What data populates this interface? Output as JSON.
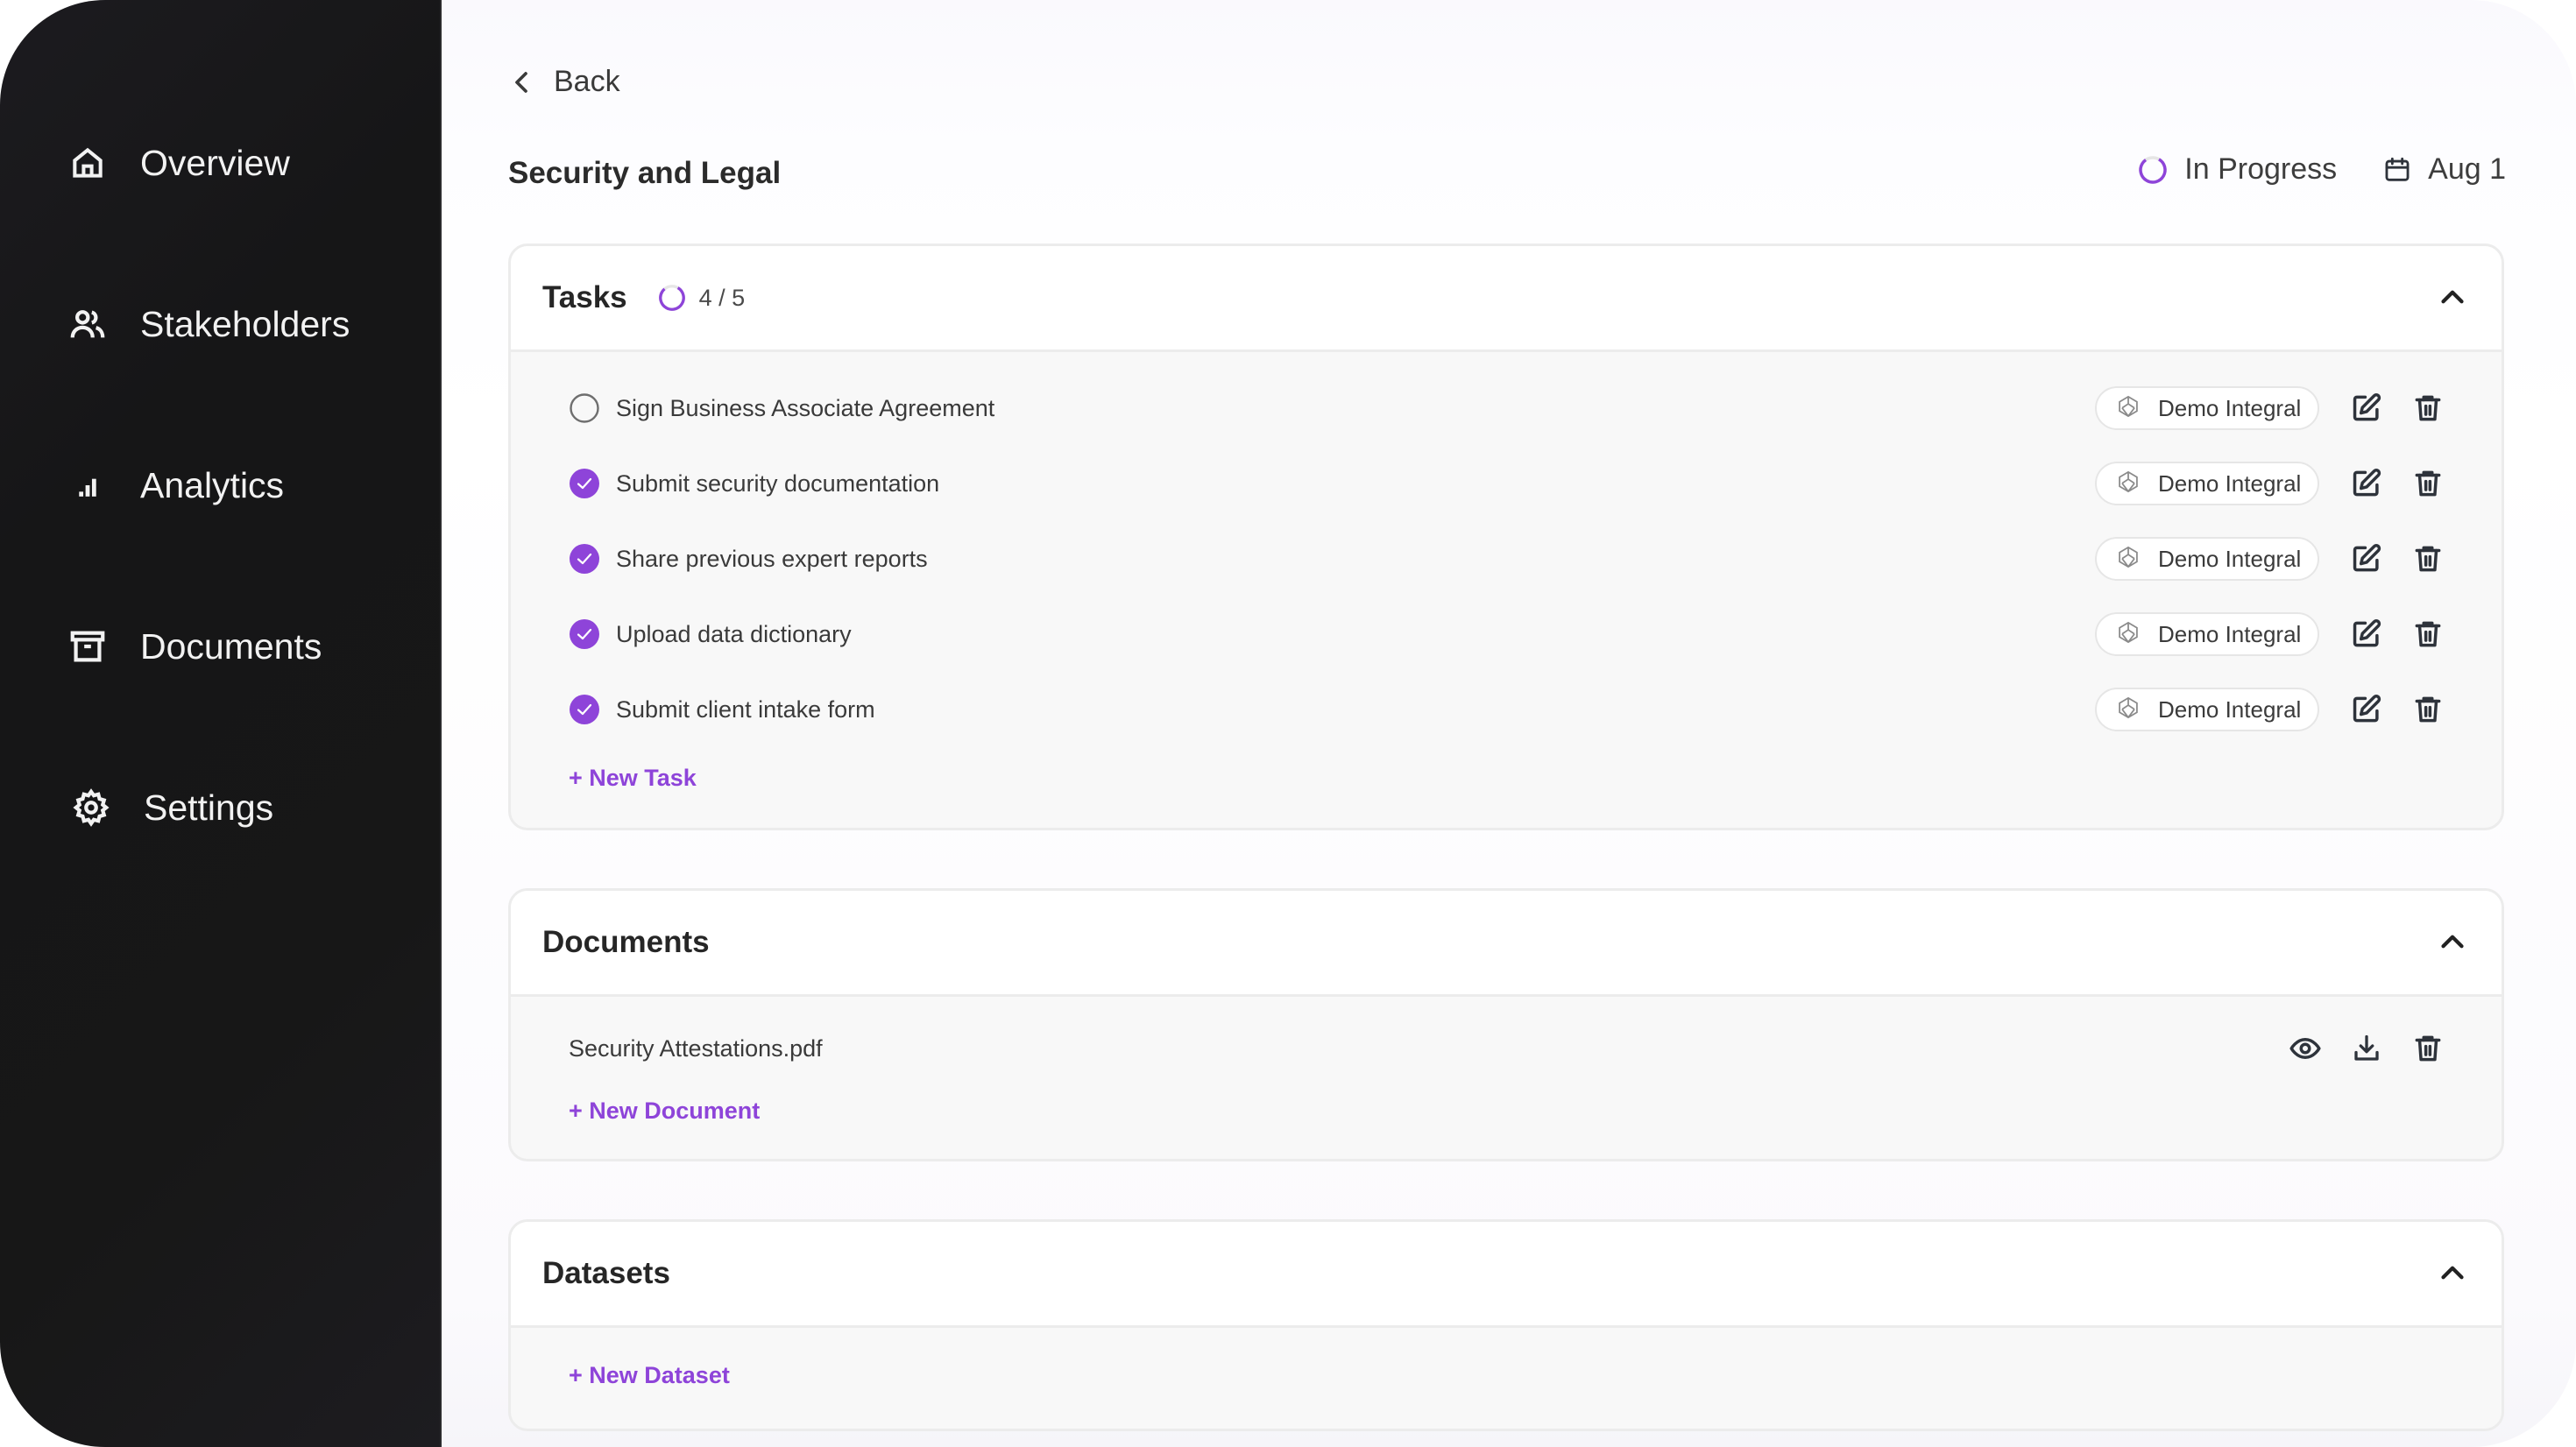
{
  "colors": {
    "accent": "#8e44d9",
    "sidebar_bg": "#171717",
    "sidebar_text": "#f2f2f2",
    "text_primary": "#2b2b2b",
    "icon_dark": "#2e333b"
  },
  "sidebar": {
    "items": [
      {
        "label": "Overview",
        "icon": "home-icon"
      },
      {
        "label": "Stakeholders",
        "icon": "users-icon"
      },
      {
        "label": "Analytics",
        "icon": "bar-chart-icon"
      },
      {
        "label": "Documents",
        "icon": "archive-box-icon"
      },
      {
        "label": "Settings",
        "icon": "gear-icon"
      }
    ]
  },
  "header": {
    "back_label": "Back",
    "title": "Security and Legal",
    "status": {
      "label": "In Progress",
      "icon": "progress-ring-icon"
    },
    "due": {
      "label": "Aug 1",
      "icon": "calendar-icon"
    }
  },
  "tasks": {
    "title": "Tasks",
    "count_label": "4 / 5",
    "completed": 4,
    "total": 5,
    "items": [
      {
        "label": "Sign Business Associate Agreement",
        "done": false,
        "assignee": "Demo Integral"
      },
      {
        "label": "Submit security documentation",
        "done": true,
        "assignee": "Demo Integral"
      },
      {
        "label": "Share previous expert reports",
        "done": true,
        "assignee": "Demo Integral"
      },
      {
        "label": "Upload data dictionary",
        "done": true,
        "assignee": "Demo Integral"
      },
      {
        "label": "Submit client intake form",
        "done": true,
        "assignee": "Demo Integral"
      }
    ],
    "add_label": "+ New Task"
  },
  "documents": {
    "title": "Documents",
    "items": [
      {
        "name": "Security Attestations.pdf"
      }
    ],
    "add_label": "+ New Document"
  },
  "datasets": {
    "title": "Datasets",
    "items": [],
    "add_label": "+ New Dataset"
  }
}
